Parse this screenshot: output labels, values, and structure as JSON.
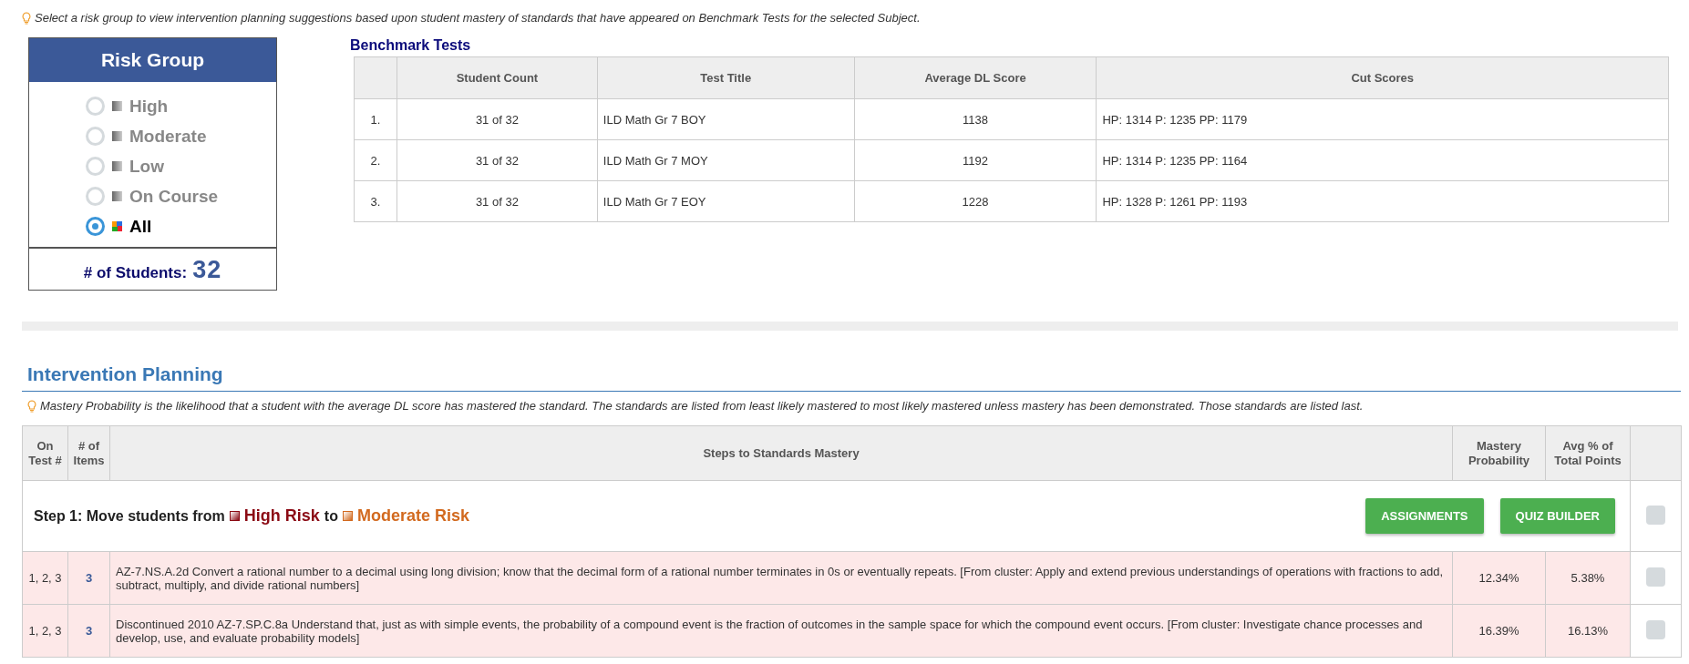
{
  "hint": "Select a risk group to view intervention planning suggestions based upon student mastery of standards that have appeared on Benchmark Tests for the selected Subject.",
  "risk_group": {
    "title": "Risk Group",
    "options": [
      {
        "label": "High",
        "selected": false
      },
      {
        "label": "Moderate",
        "selected": false
      },
      {
        "label": "Low",
        "selected": false
      },
      {
        "label": "On Course",
        "selected": false
      },
      {
        "label": "All",
        "selected": true
      }
    ],
    "students_label": "# of Students:",
    "students_count": "32"
  },
  "benchmark": {
    "title": "Benchmark Tests",
    "columns": [
      "",
      "Student Count",
      "Test Title",
      "Average DL Score",
      "Cut Scores"
    ],
    "rows": [
      [
        "1.",
        "31 of 32",
        "ILD Math Gr 7 BOY",
        "1138",
        "HP: 1314 P: 1235 PP: 1179"
      ],
      [
        "2.",
        "31 of 32",
        "ILD Math Gr 7 MOY",
        "1192",
        "HP: 1314 P: 1235 PP: 1164"
      ],
      [
        "3.",
        "31 of 32",
        "ILD Math Gr 7 EOY",
        "1228",
        "HP: 1328 P: 1261 PP: 1193"
      ]
    ]
  },
  "intervention": {
    "title": "Intervention Planning",
    "hint": "Mastery Probability is the likelihood that a student with the average DL score has mastered the standard. The standards are listed from least likely mastered to most likely mastered unless mastery has been demonstrated. Those standards are listed last.",
    "columns": [
      "On Test #",
      "# of Items",
      "Steps to Standards Mastery",
      "Mastery Probability",
      "Avg % of Total Points"
    ],
    "step": {
      "prefix": "Step 1: Move students from",
      "from": {
        "label": "High Risk",
        "color": "#8b0a14"
      },
      "joiner": "to",
      "to": {
        "label": "Moderate Risk",
        "color": "#d2691e"
      },
      "buttons": [
        "ASSIGNMENTS",
        "QUIZ BUILDER"
      ],
      "checked": false
    },
    "rows": [
      {
        "on_test": "1, 2, 3",
        "items": "3",
        "standard": "AZ-7.NS.A.2d Convert a rational number to a decimal using long division; know that the decimal form of a rational number terminates in 0s or eventually repeats. [From cluster: Apply and extend previous understandings of operations with fractions to add, subtract, multiply, and divide rational numbers]",
        "mastery": "12.34%",
        "avg": "5.38%",
        "checked": false
      },
      {
        "on_test": "1, 2, 3",
        "items": "3",
        "standard": "Discontinued 2010 AZ-7.SP.C.8a Understand that, just as with simple events, the probability of a compound event is the fraction of outcomes in the sample space for which the compound event occurs. [From cluster: Investigate chance processes and develop, use, and evaluate probability models]",
        "mastery": "16.39%",
        "avg": "16.13%",
        "checked": false
      }
    ]
  }
}
